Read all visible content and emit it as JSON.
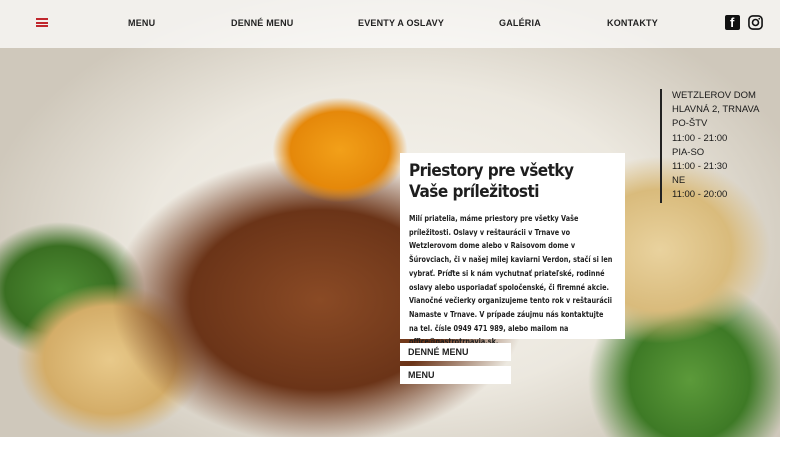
{
  "nav": {
    "items": [
      "MENU",
      "DENNÉ MENU",
      "EVENTY A OSLAVY",
      "GALÉRIA",
      "KONTAKTY"
    ]
  },
  "social": {
    "facebook": "f"
  },
  "hours": {
    "lines": [
      "WETZLEROV DOM",
      "HLAVNÁ 2, TRNAVA",
      "PO-ŠTV",
      "11:00 - 21:00",
      "PIA-SO",
      "11:00 - 21:30",
      "NE",
      "11:00 - 20:00"
    ]
  },
  "card": {
    "title_line1": "Priestory pre všetky",
    "title_line2": "Vaše príležitosti",
    "text": "Milí priatelia, máme priestory pre všetky Vaše príležitosti. Oslavy v reštaurácii v Trnave vo Wetzlerovom dome alebo v Raisovom dome v Šúrovciach, či v našej milej kaviarni Verdon, stačí si len vybrať. Príďte si k nám vychutnať priateľské, rodinné oslavy alebo usporiadať spoločenské, či firemné akcie. Vianočné večierky organizujeme tento rok v reštaurácii Namaste v Trnave. V prípade záujmu nás kontaktujte na tel. čísle 0949 471 989, alebo mailom na office@gastrotrnavia.sk."
  },
  "buttons": {
    "daily_menu": "DENNÉ MENU",
    "menu": "MENU"
  },
  "colors": {
    "accent": "#c0272d",
    "nav_bg": "#ffffff",
    "text": "#1e1e1e"
  },
  "icons": {
    "hamburger": "hamburger-menu-icon",
    "facebook": "facebook-icon",
    "instagram": "instagram-icon"
  }
}
